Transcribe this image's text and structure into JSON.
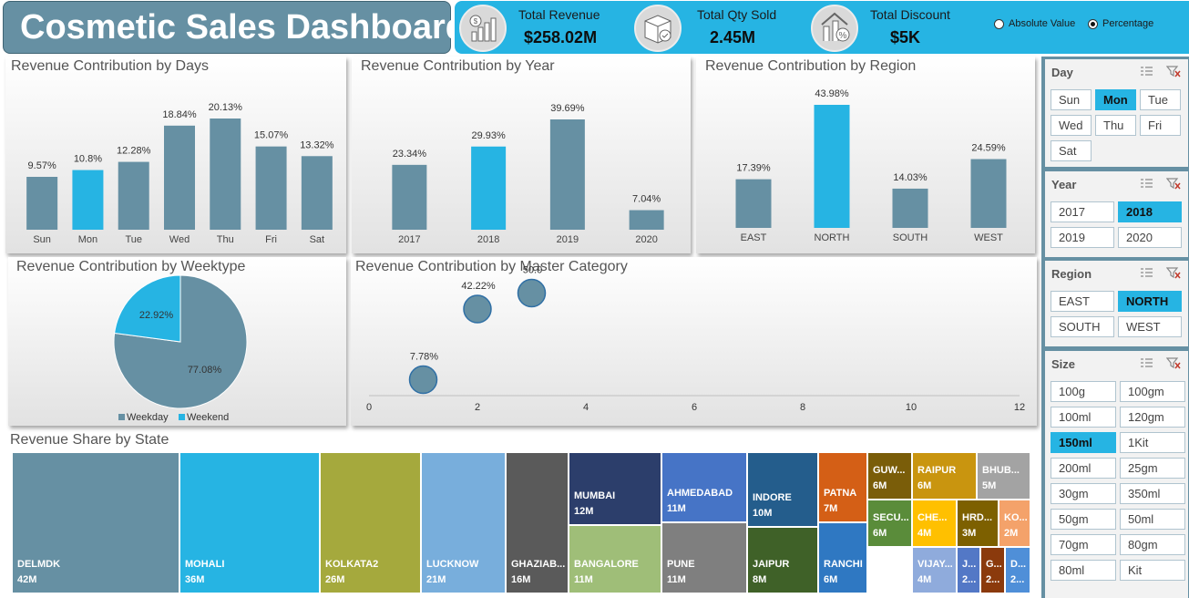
{
  "header": {
    "title": "Cosmetic Sales Dashboard"
  },
  "kpis": [
    {
      "label": "Total Revenue",
      "value": "$258.02M",
      "icon": "revenue-chart-icon"
    },
    {
      "label": "Total Qty Sold",
      "value": "2.45M",
      "icon": "package-icon"
    },
    {
      "label": "Total Discount",
      "value": "$5K",
      "icon": "discount-percent-icon"
    }
  ],
  "toggle": {
    "options": [
      "Absolute Value",
      "Percentage"
    ],
    "selected": "Percentage"
  },
  "colors": {
    "bar": "#6690a3",
    "highlight": "#26b4e3",
    "slicer_bg": "#6690a3"
  },
  "charts": {
    "days": {
      "title": "Revenue Contribution by Days",
      "type": "bar",
      "categories": [
        "Sun",
        "Mon",
        "Tue",
        "Wed",
        "Thu",
        "Fri",
        "Sat"
      ],
      "values": [
        9.57,
        10.8,
        12.28,
        18.84,
        20.13,
        15.07,
        13.32
      ],
      "labels": [
        "9.57%",
        "10.8%",
        "12.28%",
        "18.84%",
        "20.13%",
        "15.07%",
        "13.32%"
      ],
      "highlight": "Mon"
    },
    "year": {
      "title": "Revenue Contribution by Year",
      "type": "bar",
      "categories": [
        "2017",
        "2018",
        "2019",
        "2020"
      ],
      "values": [
        23.34,
        29.93,
        39.69,
        7.04
      ],
      "labels": [
        "23.34%",
        "29.93%",
        "39.69%",
        "7.04%"
      ],
      "highlight": "2018"
    },
    "region": {
      "title": "Revenue Contribution by Region",
      "type": "bar",
      "categories": [
        "EAST",
        "NORTH",
        "SOUTH",
        "WEST"
      ],
      "values": [
        17.39,
        43.98,
        14.03,
        24.59
      ],
      "labels": [
        "17.39%",
        "43.98%",
        "14.03%",
        "24.59%"
      ],
      "highlight": "NORTH"
    },
    "weektype": {
      "title": "Revenue Contribution by Weektype",
      "type": "pie",
      "slices": [
        {
          "name": "Weekday",
          "value": 77.08,
          "label": "77.08%"
        },
        {
          "name": "Weekend",
          "value": 22.92,
          "label": "22.92%"
        }
      ]
    },
    "master": {
      "title": "Revenue Contribution by Master Category",
      "type": "scatter",
      "xticks": [
        "0",
        "2",
        "4",
        "6",
        "8",
        "10",
        "12"
      ],
      "xlim": [
        0,
        12
      ],
      "points": [
        {
          "x": 1,
          "y": 7.78,
          "label": "7.78%"
        },
        {
          "x": 2,
          "y": 42.22,
          "label": "42.22%"
        },
        {
          "x": 3,
          "y": 50.0,
          "label": "50.0"
        }
      ],
      "ylim": [
        0,
        60
      ]
    },
    "state": {
      "title": "Revenue Share by State",
      "type": "treemap",
      "tiles": [
        {
          "name": "DELMDK",
          "value": "42M"
        },
        {
          "name": "MOHALI",
          "value": "36M"
        },
        {
          "name": "KOLKATA2",
          "value": "26M"
        },
        {
          "name": "LUCKNOW",
          "value": "21M"
        },
        {
          "name": "GHAZIAB...",
          "value": "16M"
        },
        {
          "name": "MUMBAI",
          "value": "12M"
        },
        {
          "name": "BANGALORE",
          "value": "11M"
        },
        {
          "name": "AHMEDABAD",
          "value": "11M"
        },
        {
          "name": "PUNE",
          "value": "11M"
        },
        {
          "name": "INDORE",
          "value": "10M"
        },
        {
          "name": "JAIPUR",
          "value": "8M"
        },
        {
          "name": "PATNA",
          "value": "7M"
        },
        {
          "name": "RANCHI",
          "value": "6M"
        },
        {
          "name": "GUW...",
          "value": "6M"
        },
        {
          "name": "SECU...",
          "value": "6M"
        },
        {
          "name": "RAIPUR",
          "value": "6M"
        },
        {
          "name": "CHE...",
          "value": "4M"
        },
        {
          "name": "VIJAY...",
          "value": "4M"
        },
        {
          "name": "HRD...",
          "value": "3M"
        },
        {
          "name": "J...",
          "value": "2..."
        },
        {
          "name": "G...",
          "value": "2..."
        },
        {
          "name": "BHUB...",
          "value": "5M"
        },
        {
          "name": "KO...",
          "value": "2M"
        },
        {
          "name": "D...",
          "value": "2..."
        }
      ]
    }
  },
  "slicers": {
    "day": {
      "title": "Day",
      "items": [
        "Sun",
        "Mon",
        "Tue",
        "Wed",
        "Thu",
        "Fri",
        "Sat"
      ],
      "selected": [
        "Mon"
      ]
    },
    "year": {
      "title": "Year",
      "items": [
        "2017",
        "2018",
        "2019",
        "2020"
      ],
      "selected": [
        "2018"
      ]
    },
    "region": {
      "title": "Region",
      "items": [
        "EAST",
        "NORTH",
        "SOUTH",
        "WEST"
      ],
      "selected": [
        "NORTH"
      ]
    },
    "size": {
      "title": "Size",
      "items": [
        "100g",
        "100gm",
        "100ml",
        "120gm",
        "150ml",
        "1Kit",
        "200ml",
        "25gm",
        "30gm",
        "350ml",
        "50gm",
        "50ml",
        "70gm",
        "80gm",
        "80ml",
        "Kit"
      ],
      "selected": [
        "150ml"
      ]
    }
  }
}
